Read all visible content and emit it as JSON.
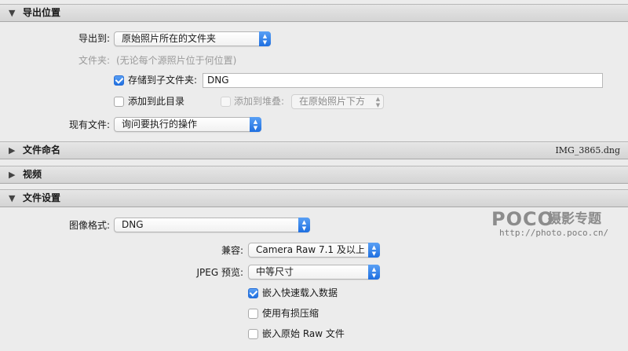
{
  "export_location": {
    "title": "导出位置",
    "export_to_label": "导出到:",
    "export_to_value": "原始照片所在的文件夹",
    "folder_label": "文件夹:",
    "folder_value": "(无论每个源照片位于何位置)",
    "subfolder_checkbox_label": "存储到子文件夹:",
    "subfolder_checked": true,
    "subfolder_value": "DNG",
    "add_to_catalog_label": "添加到此目录",
    "add_to_stack_label": "添加到堆叠:",
    "stack_position_value": "在原始照片下方",
    "existing_files_label": "现有文件:",
    "existing_files_value": "询问要执行的操作"
  },
  "file_naming": {
    "title": "文件命名",
    "filename": "IMG_3865.dng"
  },
  "video": {
    "title": "视频"
  },
  "file_settings": {
    "title": "文件设置",
    "image_format_label": "图像格式:",
    "image_format_value": "DNG",
    "compatibility_label": "兼容:",
    "compatibility_value": "Camera Raw 7.1 及以上",
    "jpeg_preview_label": "JPEG 预览:",
    "jpeg_preview_value": "中等尺寸",
    "embed_fast_load_label": "嵌入快速载入数据",
    "embed_fast_load_checked": true,
    "lossy_compression_label": "使用有损压缩",
    "embed_raw_label": "嵌入原始 Raw 文件"
  },
  "watermark": {
    "brand": "POCO",
    "subtitle": "摄影专题",
    "url": "http://photo.poco.cn/"
  },
  "colors": {
    "accent": "#2a78e8",
    "panel_bg": "#ececec",
    "header_bg": "#dadada"
  }
}
